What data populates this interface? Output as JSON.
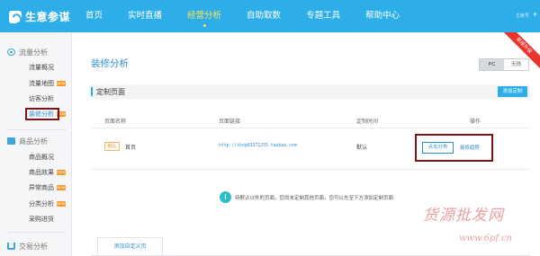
{
  "header": {
    "logo_text": "生意参谋",
    "nav": [
      {
        "label": "首页"
      },
      {
        "label": "实时直播"
      },
      {
        "label": "经营分析",
        "active": true
      },
      {
        "label": "自助取数"
      },
      {
        "label": "专题工具"
      },
      {
        "label": "帮助中心"
      }
    ],
    "user_text": "主帐号"
  },
  "sidebar": {
    "groups": [
      {
        "title": "流量分析",
        "icon": "eye-icon",
        "items": [
          {
            "label": "流量概况"
          },
          {
            "label": "流量地图",
            "badge": "NEW"
          },
          {
            "label": "访客分析"
          },
          {
            "label": "装修分析",
            "badge": "NEW",
            "selected": true
          }
        ]
      },
      {
        "title": "商品分析",
        "icon": "box-icon",
        "items": [
          {
            "label": "商品概况"
          },
          {
            "label": "商品效果",
            "badge": "NEW"
          },
          {
            "label": "异常商品",
            "badge": "NEW"
          },
          {
            "label": "分类分析",
            "badge": "NEW"
          },
          {
            "label": "采购进货"
          }
        ]
      },
      {
        "title": "交易分析",
        "icon": "cart-icon",
        "items": []
      }
    ]
  },
  "main": {
    "title": "装修分析",
    "device_toggle": {
      "options": [
        "PC",
        "无线"
      ],
      "selected": "PC"
    },
    "ribbon": "新版升级",
    "section_title": "定制页面",
    "add_button": "添加定制",
    "columns": [
      "页面名称",
      "页面链接",
      "定制时间",
      "操作"
    ],
    "rows": [
      {
        "tag": "默认",
        "name": "首页",
        "link": "http://shop63371255.taobao.com",
        "time": "默认",
        "actions": [
          "点击分布",
          "装修趋势"
        ]
      }
    ],
    "info": "待默认以外的页面，您尚未定制其他页面，您可以先至下方添加定制页面",
    "tab": "添加自定义页"
  },
  "colors": {
    "brand": "#2eaee9",
    "highlight_box": "#7a1418",
    "badge": "#f49a2b",
    "ribbon": "#e8342c"
  },
  "watermark": {
    "line1": "货源批发网",
    "line2": "www.6pf.cn"
  }
}
